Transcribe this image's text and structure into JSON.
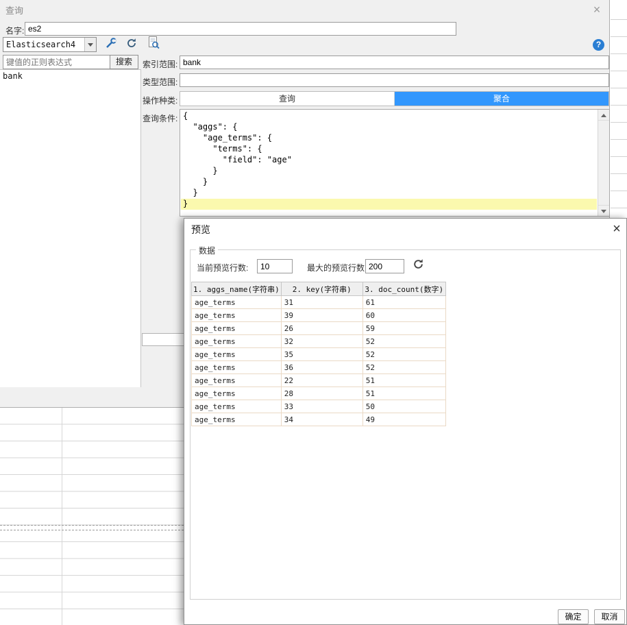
{
  "colors": {
    "accent_blue": "#3297fd",
    "highlight_yellow": "#fbf9ae",
    "table_border_tan": "#ead9c5"
  },
  "icons": {
    "help_glyph": "?",
    "close_glyph": "×"
  },
  "query_dialog": {
    "title": "查询",
    "name_label": "名字:",
    "name_value": "es2",
    "datasource_select": "Elasticsearch4",
    "search": {
      "placeholder": "键值的正则表达式",
      "button": "搜索"
    },
    "list_items": [
      "bank"
    ],
    "form": {
      "index_label": "索引范围:",
      "index_value": "bank",
      "type_label": "类型范围:",
      "type_value": "",
      "op_label": "操作种类:",
      "tabs": [
        {
          "label": "查询",
          "active": false
        },
        {
          "label": "聚合",
          "active": true
        }
      ],
      "condition_label": "查询条件:"
    },
    "editor": {
      "lines": [
        "{",
        "  \"aggs\": {",
        "    \"age_terms\": {",
        "      \"terms\": {",
        "        \"field\": \"age\"",
        "      }",
        "    }",
        "  }",
        "}"
      ],
      "highlight_line": 8
    }
  },
  "preview_dialog": {
    "title": "预览",
    "group_label": "数据",
    "current_rows_label": "当前预览行数:",
    "current_rows_value": "10",
    "max_rows_label": "最大的预览行数:",
    "max_rows_value": "200",
    "table": {
      "headers": [
        "1. aggs_name(字符串)",
        "2. key(字符串)",
        "3. doc_count(数字)"
      ],
      "rows": [
        [
          "age_terms",
          "31",
          "61"
        ],
        [
          "age_terms",
          "39",
          "60"
        ],
        [
          "age_terms",
          "26",
          "59"
        ],
        [
          "age_terms",
          "32",
          "52"
        ],
        [
          "age_terms",
          "35",
          "52"
        ],
        [
          "age_terms",
          "36",
          "52"
        ],
        [
          "age_terms",
          "22",
          "51"
        ],
        [
          "age_terms",
          "28",
          "51"
        ],
        [
          "age_terms",
          "33",
          "50"
        ],
        [
          "age_terms",
          "34",
          "49"
        ]
      ]
    },
    "ok_label": "确定",
    "cancel_label": "取消"
  }
}
